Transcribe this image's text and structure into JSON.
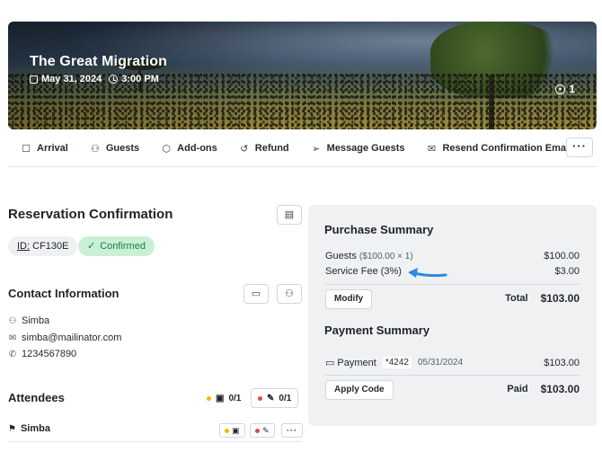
{
  "event": {
    "title": "The Great Migration",
    "date": "May 31, 2024",
    "time": "3:00 PM",
    "count": "1"
  },
  "actions": [
    {
      "label": "Arrival",
      "icon": "checkbox-icon"
    },
    {
      "label": "Guests",
      "icon": "user-icon"
    },
    {
      "label": "Add-ons",
      "icon": "box-icon"
    },
    {
      "label": "Refund",
      "icon": "refund-icon"
    },
    {
      "label": "Message Guests",
      "icon": "send-icon"
    },
    {
      "label": "Resend Confirmation Email",
      "icon": "mail-icon"
    }
  ],
  "reservation": {
    "title": "Reservation Confirmation",
    "id_label": "ID:",
    "id_value": "CF130E",
    "status": "Confirmed",
    "status_color": "#1a7f37"
  },
  "contact": {
    "title": "Contact Information",
    "name": "Simba",
    "email": "simba@mailinator.com",
    "phone": "1234567890"
  },
  "attendees": {
    "title": "Attendees",
    "waiver_count": "0/1",
    "form_count": "0/1",
    "rows": [
      {
        "name": "Simba"
      }
    ]
  },
  "purchase": {
    "title": "Purchase Summary",
    "guests_label": "Guests",
    "guests_detail": "($100.00 × 1)",
    "guests_amount": "$100.00",
    "fee_label": "Service Fee (3%)",
    "fee_amount": "$3.00",
    "modify_label": "Modify",
    "total_label": "Total",
    "total_amount": "$103.00"
  },
  "payment": {
    "title": "Payment Summary",
    "label": "Payment",
    "card": "*4242",
    "date": "05/31/2024",
    "amount": "$103.00",
    "apply_code_label": "Apply Code",
    "paid_label": "Paid",
    "paid_amount": "$103.00"
  },
  "colors": {
    "accent_arrow": "#2d8ae0",
    "panel_bg": "#eff1f3",
    "confirmed_bg": "#c9f0d6"
  }
}
